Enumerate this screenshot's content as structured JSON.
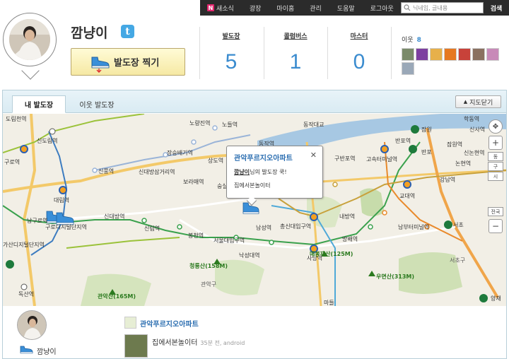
{
  "gnb": {
    "n_badge": "N",
    "items": [
      "새소식",
      "광장",
      "마이홈",
      "관리",
      "도움말",
      "로그아웃"
    ],
    "search_placeholder": "닉네임, 글내용",
    "search_button": "검색"
  },
  "profile": {
    "name": "깜냥이",
    "twitter_icon": "t",
    "checkin_label": "발도장 찍기"
  },
  "stats": [
    {
      "label": "발도장",
      "value": "5"
    },
    {
      "label": "콜럼버스",
      "value": "1"
    },
    {
      "label": "마스터",
      "value": "0"
    }
  ],
  "friends": {
    "label": "이웃",
    "count": "8"
  },
  "map_panel": {
    "tabs": [
      "내 발도장",
      "이웃 발도장"
    ],
    "close_label": "지도닫기",
    "labels": {
      "l1": "도림천역",
      "l2": "신도림역",
      "l3": "구로역",
      "l4": "대림역",
      "l5": "남구로역",
      "l6": "구로디지털단지역",
      "l7": "가산디지털단지역",
      "l8": "독산역",
      "l9": "노량진역",
      "l10": "노들역",
      "l11": "장승배기역",
      "l12": "상도역",
      "l13": "신풍역",
      "l14": "신대방삼거리역",
      "l15": "보라매역",
      "l16": "신대방역",
      "l17": "신림역",
      "l18": "봉천역",
      "l19": "서울대입구역",
      "l20": "낙성대역",
      "l21": "숭실",
      "l22": "남성역",
      "l23": "총신대입구역",
      "l24": "사당역",
      "l25": "방배역",
      "l26": "내방역",
      "l27": "동작대교",
      "l28": "동작역",
      "l29": "구반포역",
      "l30": "고속터미널역",
      "l31": "반포역",
      "l32": "교대역",
      "l33": "남부터미널역",
      "l34": "서초",
      "l35": "서초구",
      "l36": "관악구",
      "l37": "잠원",
      "l38": "신사역",
      "l39": "잠원역",
      "l40": "반포",
      "l41": "논현역",
      "l42": "학동역",
      "l43": "신논현역",
      "l44": "강남역",
      "l45": "양재",
      "l46": "청룡산(158M)",
      "l47": "관악산(165M)",
      "l48": "매봉재산(125M)",
      "l49": "우면산(313M)",
      "l50": "마들",
      "l51": "구로디지털단지역",
      "l52": "가산디지털단지역"
    },
    "popup": {
      "title": "관악푸르지오아파트",
      "user": "깜냥이",
      "line_suffix": "님의 발도장 쿡!",
      "message": "집에서본놀이터",
      "close": "✕"
    },
    "zoom": {
      "plus": "+",
      "minus": "−",
      "levels": [
        "동",
        "구",
        "시",
        "전국"
      ]
    }
  },
  "feed": {
    "name": "깜냥이",
    "place": "관악푸르지오아파트",
    "message": "집에서본놀이터",
    "time": "35분 전, android"
  }
}
